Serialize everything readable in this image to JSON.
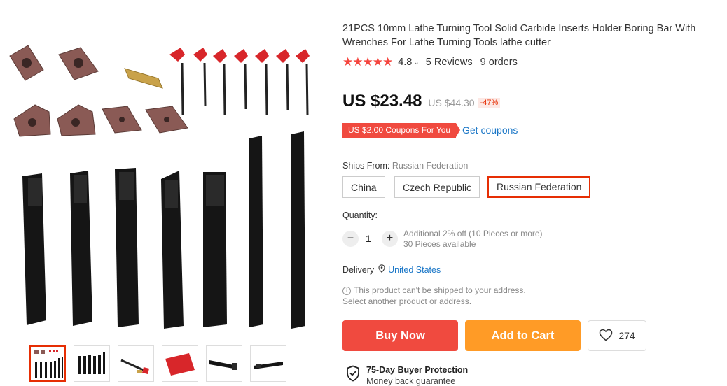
{
  "product": {
    "title": "21PCS 10mm Lathe Turning Tool Solid Carbide Inserts Holder Boring Bar With Wrenches For Lathe Turning Tools lathe cutter",
    "rating_stars": "★★★★★",
    "rating_value": "4.8",
    "reviews": "5 Reviews",
    "orders": "9 orders"
  },
  "price": {
    "current": "US $23.48",
    "original": "US $44.30",
    "discount": "-47%"
  },
  "coupon": {
    "badge": "US $2.00 Coupons For You",
    "link": "Get coupons"
  },
  "ships": {
    "label": "Ships From:",
    "value": "Russian Federation",
    "options": [
      "China",
      "Czech Republic",
      "Russian Federation"
    ]
  },
  "quantity": {
    "label": "Quantity:",
    "value": "1",
    "minus": "−",
    "plus": "+",
    "note": "Additional 2% off (10 Pieces or more)",
    "available": "30 Pieces available"
  },
  "delivery": {
    "label": "Delivery",
    "country": "United States",
    "warning": "This product can't be shipped to your address.",
    "warning2": "Select another product or address."
  },
  "actions": {
    "buy_now": "Buy Now",
    "add_to_cart": "Add to Cart",
    "wishlist_count": "274"
  },
  "protection": {
    "title": "75-Day Buyer Protection",
    "subtitle": "Money back guarantee"
  },
  "colors": {
    "accent": "#e62e04",
    "buy": "#f04a3f",
    "cart": "#ff9b26",
    "link": "#1b77c7"
  }
}
